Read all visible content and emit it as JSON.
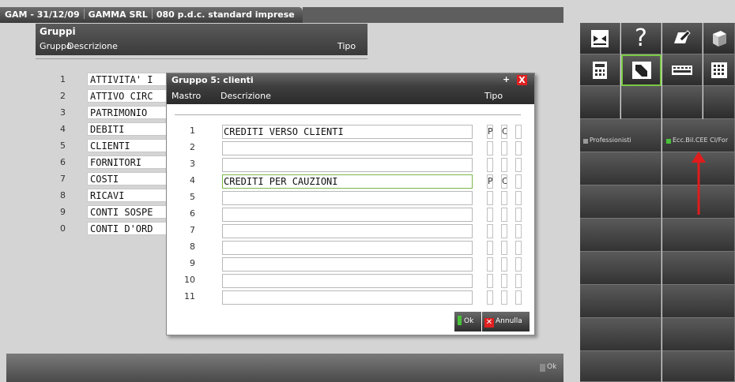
{
  "top_tab": {
    "company_date": "GAM - 31/12/09",
    "company_name": "GAMMA SRL",
    "plan_name": "080 p.d.c. standard imprese"
  },
  "gruppi": {
    "title": "Gruppi",
    "columns": {
      "gruppo": "Gruppo",
      "descrizione": "Descrizione",
      "tipo": "Tipo"
    },
    "rows": [
      {
        "num": "1",
        "descr": "ATTIVITA' I"
      },
      {
        "num": "2",
        "descr": "ATTIVO CIRC"
      },
      {
        "num": "3",
        "descr": "PATRIMONIO"
      },
      {
        "num": "4",
        "descr": "DEBITI"
      },
      {
        "num": "5",
        "descr": "CLIENTI"
      },
      {
        "num": "6",
        "descr": "FORNITORI"
      },
      {
        "num": "7",
        "descr": "COSTI"
      },
      {
        "num": "8",
        "descr": "RICAVI"
      },
      {
        "num": "9",
        "descr": "CONTI SOSPE"
      },
      {
        "num": "0",
        "descr": "CONTI D'ORD"
      }
    ]
  },
  "dialog": {
    "title": "Gruppo 5: clienti",
    "restore_glyph": "+",
    "close_glyph": "X",
    "columns": {
      "mastro": "Mastro",
      "descrizione": "Descrizione",
      "tipo": "Tipo"
    },
    "rows": [
      {
        "num": "1",
        "descr": "CREDITI VERSO CLIENTI",
        "t1": "P",
        "t2": "C"
      },
      {
        "num": "2",
        "descr": "",
        "t1": "",
        "t2": ""
      },
      {
        "num": "3",
        "descr": "",
        "t1": "",
        "t2": ""
      },
      {
        "num": "4",
        "descr": "CREDITI PER CAUZIONI",
        "t1": "P",
        "t2": "C"
      },
      {
        "num": "5",
        "descr": "",
        "t1": "",
        "t2": ""
      },
      {
        "num": "6",
        "descr": "",
        "t1": "",
        "t2": ""
      },
      {
        "num": "7",
        "descr": "",
        "t1": "",
        "t2": ""
      },
      {
        "num": "8",
        "descr": "",
        "t1": "",
        "t2": ""
      },
      {
        "num": "9",
        "descr": "",
        "t1": "",
        "t2": ""
      },
      {
        "num": "10",
        "descr": "",
        "t1": "",
        "t2": ""
      },
      {
        "num": "11",
        "descr": "",
        "t1": "",
        "t2": ""
      }
    ],
    "focused_row": "4",
    "ok_label": "Ok",
    "cancel_label": "Annulla"
  },
  "bottom": {
    "ok_label": "Ok"
  },
  "right_panel": {
    "professionisti_label": "Professionisti",
    "ecc_label": "Ecc.Bil.CEE Cl/For",
    "colors": {
      "accent_green": "#4ac23a",
      "grey_mark": "#9a9a9a",
      "arrow_red": "#e01c1c"
    }
  }
}
